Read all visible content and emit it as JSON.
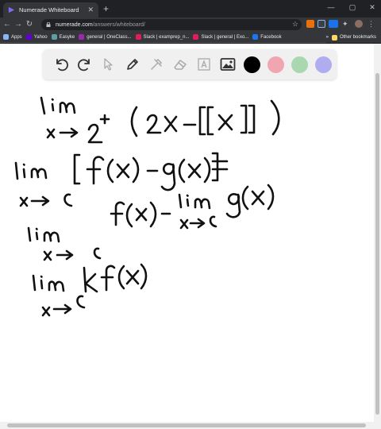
{
  "browser": {
    "tab_title": "Numerade Whiteboard",
    "tab_close": "✕",
    "new_tab": "+",
    "win_min": "—",
    "win_max": "▢",
    "win_close": "✕",
    "url_host": "numerade.com",
    "url_path": "/answers/whiteboard/"
  },
  "bookmarks": {
    "items": [
      {
        "label": "Apps",
        "color": "#8ab4f8"
      },
      {
        "label": "Yahoo",
        "color": "#6001d2"
      },
      {
        "label": "Easyke",
        "color": "#5f9ea0"
      },
      {
        "label": "general | OneClass...",
        "color": "#9c27b0"
      },
      {
        "label": "Slack | examprep_n...",
        "color": "#e01e5a"
      },
      {
        "label": "Slack | general | Exo...",
        "color": "#e01e5a"
      },
      {
        "label": "Facebook",
        "color": "#1877f2"
      }
    ],
    "more": "»",
    "other": "Other bookmarks"
  },
  "whiteboard": {
    "colors": {
      "black": "#000000",
      "red": "#f0a6b1",
      "green": "#a9d8b0",
      "purple": "#b0acf0"
    },
    "tools": [
      "undo-icon",
      "redo-icon",
      "cursor-icon",
      "pen-icon",
      "tools-icon",
      "eraser-icon",
      "text-icon",
      "image-icon"
    ]
  }
}
